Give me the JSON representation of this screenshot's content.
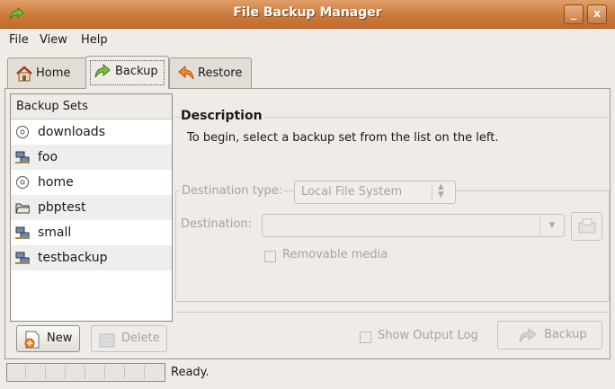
{
  "window": {
    "title": "File Backup Manager",
    "minimize": "_",
    "close": "x"
  },
  "menu": [
    "File",
    "View",
    "Help"
  ],
  "tabs": [
    {
      "label": "Home",
      "icon": "home-icon"
    },
    {
      "label": "Backup",
      "icon": "backup-arrow-icon",
      "active": true
    },
    {
      "label": "Restore",
      "icon": "restore-arrow-icon"
    }
  ],
  "backup_sets": {
    "header": "Backup Sets",
    "items": [
      {
        "label": "downloads",
        "icon": "disc-icon"
      },
      {
        "label": "foo",
        "icon": "network-icon"
      },
      {
        "label": "home",
        "icon": "disc-icon"
      },
      {
        "label": "pbptest",
        "icon": "folder-icon"
      },
      {
        "label": "small",
        "icon": "network-icon"
      },
      {
        "label": "testbackup",
        "icon": "network-icon"
      }
    ],
    "new_label": "New",
    "delete_label": "Delete"
  },
  "description": {
    "title": "Description",
    "text": "To begin, select a backup set from the list on the left."
  },
  "destination": {
    "type_label": "Destination type:",
    "type_value": "Local File System",
    "dest_label": "Destination:",
    "dest_value": "",
    "removable_label": "Removable media",
    "removable_checked": false
  },
  "footer": {
    "show_log_label": "Show Output Log",
    "show_log_checked": false,
    "backup_label": "Backup"
  },
  "status": {
    "text": "Ready."
  },
  "colors": {
    "titlebar": "#cc7a3d",
    "background": "#efebe7",
    "disabled_text": "#a9a39c"
  }
}
